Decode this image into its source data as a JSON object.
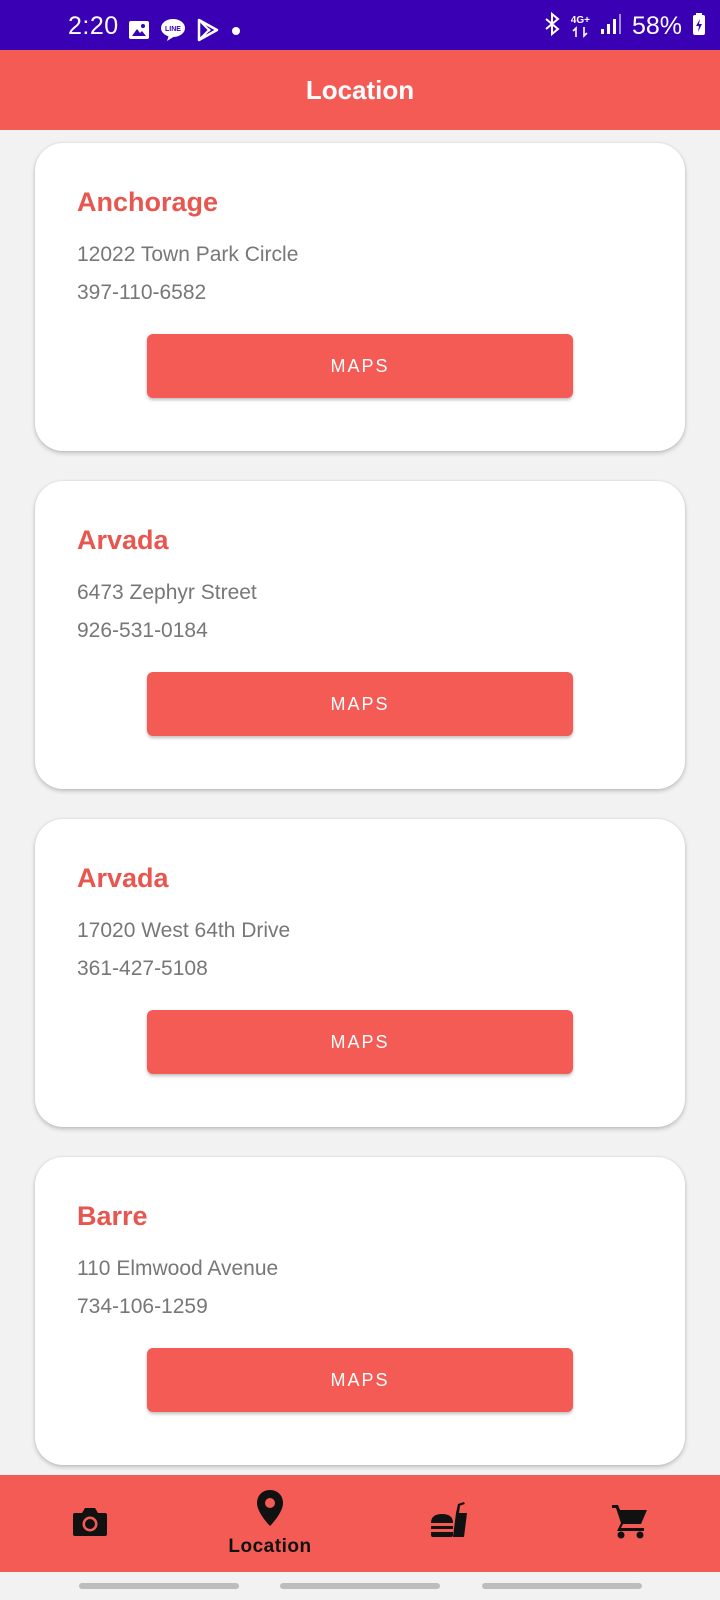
{
  "status_bar": {
    "time": "2:20",
    "battery": "58%",
    "network": "4G+",
    "left_icons": [
      "gallery-icon",
      "line-icon",
      "play-store-icon",
      "dot-icon"
    ],
    "right_icons": [
      "bluetooth-icon",
      "network-4g-icon",
      "signal-icon",
      "battery-icon"
    ]
  },
  "app_bar": {
    "title": "Location"
  },
  "locations": [
    {
      "city": "Anchorage",
      "address": "12022 Town Park Circle",
      "phone": "397-110-6582",
      "button": "MAPS"
    },
    {
      "city": "Arvada",
      "address": "6473 Zephyr Street",
      "phone": "926-531-0184",
      "button": "MAPS"
    },
    {
      "city": "Arvada",
      "address": "17020 West 64th Drive",
      "phone": "361-427-5108",
      "button": "MAPS"
    },
    {
      "city": "Barre",
      "address": "110 Elmwood Avenue",
      "phone": "734-106-1259",
      "button": "MAPS"
    }
  ],
  "bottom_nav": {
    "items": [
      {
        "icon": "camera-icon",
        "label": ""
      },
      {
        "icon": "location-pin-icon",
        "label": "Location"
      },
      {
        "icon": "fast-food-icon",
        "label": ""
      },
      {
        "icon": "cart-icon",
        "label": ""
      }
    ],
    "active_index": 1
  },
  "colors": {
    "status_bar": "#3a00b4",
    "accent": "#f55b55",
    "title_text": "#e8574f",
    "background": "#f2f2f2"
  }
}
